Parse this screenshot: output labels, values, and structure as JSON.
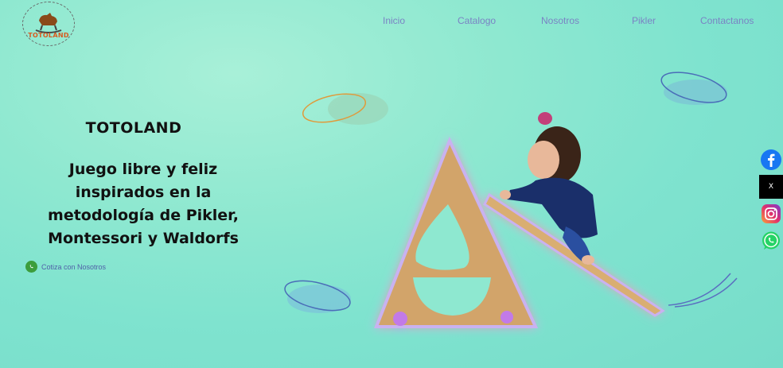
{
  "brand": {
    "logo_text": "TOTOLAND"
  },
  "nav": {
    "items": [
      {
        "label": "Inicio"
      },
      {
        "label": "Catalogo"
      },
      {
        "label": "Nosotros"
      },
      {
        "label": "Pikler"
      },
      {
        "label": "Contactanos"
      }
    ]
  },
  "hero": {
    "title": "TOTOLAND",
    "subtitle_lines": [
      "Juego libre y feliz",
      "inspirados en la",
      "metodología de Pikler,",
      "Montessori y Waldorfs"
    ],
    "cta_label": "Cotiza con Nosotros",
    "cta_icon": "whatsapp-icon"
  },
  "social": {
    "items": [
      {
        "icon": "facebook-icon",
        "color": "#1877f2"
      },
      {
        "icon": "x-icon",
        "glyph": "X",
        "color": "#000000"
      },
      {
        "icon": "instagram-icon",
        "color": "#e1306c"
      },
      {
        "icon": "whatsapp-icon",
        "color": "#25d366"
      }
    ]
  },
  "colors": {
    "nav_text": "#7a83c4",
    "background": "#8ee8d0",
    "heading": "#111111"
  }
}
